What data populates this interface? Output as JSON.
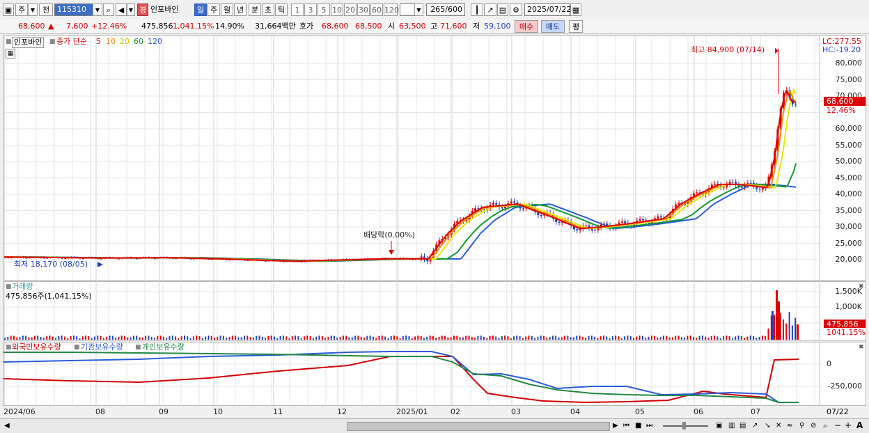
{
  "toolbar": {
    "market_label": "주",
    "prev_label": "전",
    "code_value": "115310",
    "badge_label": "경",
    "stock_name": "인포바인",
    "periods": [
      "일",
      "주",
      "월",
      "년",
      "분",
      "초",
      "틱"
    ],
    "intervals": [
      "1",
      "3",
      "5",
      "10",
      "20",
      "30",
      "60",
      "120"
    ],
    "count_value": "265",
    "count_total": "/600",
    "date_value": "2025/07/22"
  },
  "info_bar": {
    "price": "68,600",
    "change": "7,600",
    "change_pct": "+12.46%",
    "volume": "475,856",
    "volume_ratio": "1,041.15%",
    "turnover": "14.90%",
    "amount": "31,664백만",
    "quote_label": "호가",
    "ask": "68,600",
    "bid": "68,500",
    "open_label": "시",
    "open": "63,500",
    "high_label": "고",
    "high": "71,600",
    "low_label": "저",
    "low": "59,100",
    "buy_label": "매수",
    "sell_label": "매도",
    "eval_label": "평"
  },
  "price_panel": {
    "stock_label": "인포바인",
    "ma_label": "종가 단순",
    "ma_periods": [
      {
        "label": "5",
        "color": "#dd0000"
      },
      {
        "label": "10",
        "color": "#f08c00"
      },
      {
        "label": "20",
        "color": "#e8e800"
      },
      {
        "label": "60",
        "color": "#119933"
      },
      {
        "label": "120",
        "color": "#2a5cdd"
      }
    ],
    "high_annotation": "최고 84,900 (07/14)",
    "low_annotation": "최저 18,170 (08/05)",
    "dividend_annotation": "배당락(0.00%)",
    "lc_label": "LC:277.55",
    "hc_label": "HC:-19.20",
    "current_price_tag": "68,600",
    "current_pct_tag": "12.46%",
    "y_labels": [
      "80,000",
      "75,000",
      "70,000",
      "65,000",
      "60,000",
      "55,000",
      "50,000",
      "45,000",
      "40,000",
      "35,000",
      "30,000",
      "25,000",
      "20,000"
    ]
  },
  "volume_panel": {
    "title": "거래량",
    "subtitle": "475,856주(1,041.15%)",
    "y_labels": [
      "1,500K",
      "1,000K"
    ],
    "tag_value": "475,856",
    "tag_pct": "1041.15%"
  },
  "holdings_panel": {
    "legend": [
      {
        "label": "외국인보유수량",
        "color": "#d20000"
      },
      {
        "label": "기관보유수량",
        "color": "#2a5cdd"
      },
      {
        "label": "개인보유수량",
        "color": "#228844"
      }
    ],
    "y_labels": [
      "0",
      "-250,000"
    ]
  },
  "x_axis": {
    "labels": [
      "2024/06",
      "08",
      "09",
      "10",
      "11",
      "12",
      "2025/01",
      "02",
      "03",
      "04",
      "05",
      "06",
      "07"
    ],
    "right_label": "07/22"
  },
  "colors": {
    "up": "#dd0000",
    "down": "#1f3fbf",
    "ma5": "#dd0000",
    "ma10": "#f08c00",
    "ma20": "#e8e800",
    "ma60": "#119933",
    "ma120": "#2a5cdd"
  }
}
